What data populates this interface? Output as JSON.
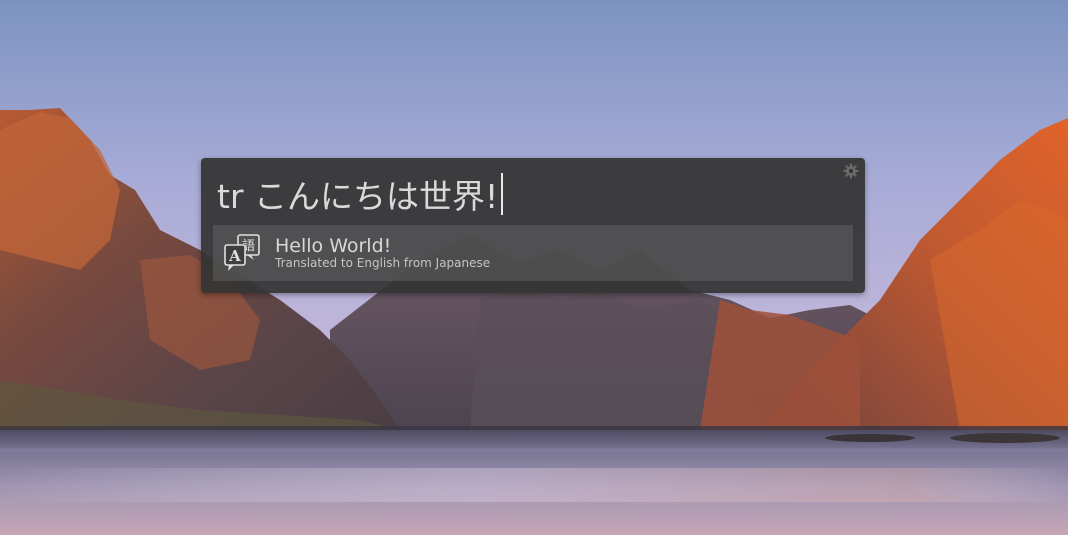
{
  "launcher": {
    "query_text": "tr こんにちは世界!",
    "settings_icon": "gear-icon"
  },
  "results": [
    {
      "icon": "translate-icon",
      "title": "Hello World!",
      "subtitle": "Translated to English from Japanese"
    }
  ],
  "colors": {
    "launcher_bg": "#343434",
    "result_bg": "#5a5a5a",
    "text": "#d8d8d8"
  }
}
